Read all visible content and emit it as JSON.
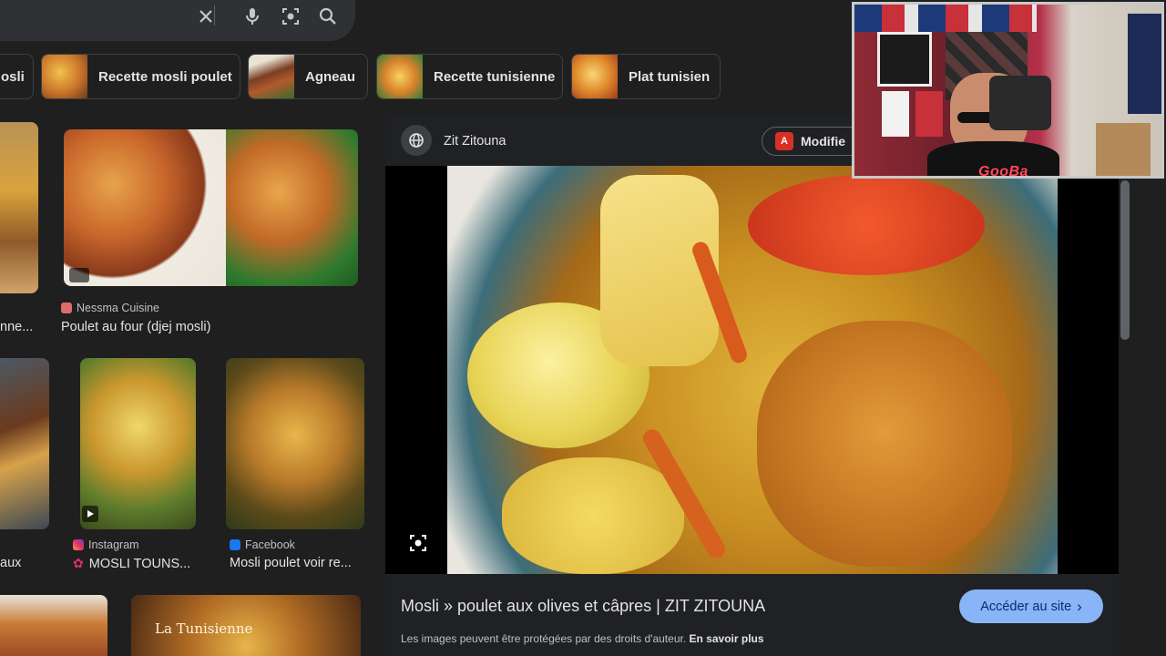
{
  "search": {
    "clear_icon": "close-icon",
    "mic_icon": "mic-icon",
    "lens_icon": "lens-icon",
    "search_icon": "search-icon"
  },
  "chips": [
    {
      "label": "osli"
    },
    {
      "label": "Recette mosli poulet"
    },
    {
      "label": "Agneau"
    },
    {
      "label": "Recette tunisienne"
    },
    {
      "label": "Plat tunisien"
    }
  ],
  "results": [
    {
      "source": "",
      "title": "nne..."
    },
    {
      "source": "Nessma Cuisine",
      "title": "Poulet au four (djej mosli)"
    },
    {
      "source": "",
      "title": "aux"
    },
    {
      "source": "Instagram",
      "title": "MOSLI TOUNS..."
    },
    {
      "source": "Facebook",
      "title": "Mosli poulet voir re..."
    },
    {
      "watermark": "La Tunisienne"
    }
  ],
  "preview": {
    "site": "Zit Zitouna",
    "pdf_button": "Modifie",
    "title": "Mosli » poulet aux olives et câpres | ZIT ZITOUNA",
    "copyright": "Les images peuvent être protégées par des droits d'auteur.",
    "learn_more": "En savoir plus",
    "visit_button": "Accéder au site",
    "visit_chevron": "›"
  },
  "webcam": {
    "tag": "GooBa"
  },
  "colors": {
    "background": "#1f1f1f",
    "accent": "#8ab4f8",
    "chip_border": "#3c4043"
  }
}
